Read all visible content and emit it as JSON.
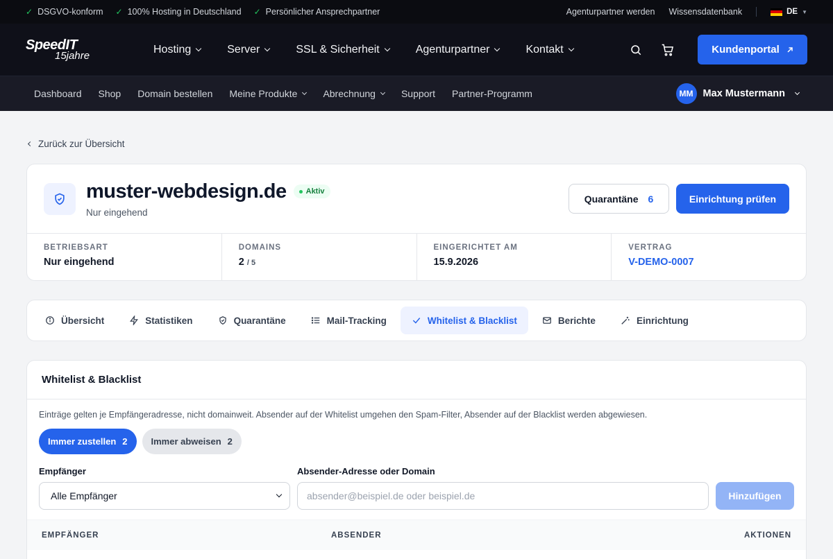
{
  "topbar": {
    "features": [
      "DSGVO-konform",
      "100% Hosting in Deutschland",
      "Persönlicher Ansprechpartner"
    ],
    "links": [
      "Agenturpartner werden",
      "Wissensdatenbank"
    ],
    "language": "DE"
  },
  "mainnav": {
    "logo_line1": "SpeedIT",
    "logo_line2": "15jahre",
    "items": [
      "Hosting",
      "Server",
      "SSL & Sicherheit",
      "Agenturpartner",
      "Kontakt"
    ],
    "portal_label": "Kundenportal"
  },
  "subnav": {
    "items": [
      "Dashboard",
      "Shop",
      "Domain bestellen",
      "Meine Produkte",
      "Abrechnung",
      "Support",
      "Partner-Programm"
    ],
    "user_initials": "MM",
    "user_name": "Max Mustermann"
  },
  "back_label": "Zurück zur Übersicht",
  "domain": {
    "name": "muster-webdesign.de",
    "status": "Aktiv",
    "subtitle": "Nur eingehend",
    "quarantine_label": "Quarantäne",
    "quarantine_count": "6",
    "check_label": "Einrichtung prüfen",
    "stats": [
      {
        "label": "BETRIEBSART",
        "value": "Nur eingehend"
      },
      {
        "label": "DOMAINS",
        "value": "2",
        "suffix": "/ 5"
      },
      {
        "label": "EINGERICHTET AM",
        "value": "15.9.2026"
      },
      {
        "label": "VERTRAG",
        "value": "V-DEMO-0007"
      }
    ]
  },
  "tabs": [
    {
      "label": "Übersicht",
      "icon": "info-icon"
    },
    {
      "label": "Statistiken",
      "icon": "bolt-icon"
    },
    {
      "label": "Quarantäne",
      "icon": "shield-icon"
    },
    {
      "label": "Mail-Tracking",
      "icon": "list-icon"
    },
    {
      "label": "Whitelist & Blacklist",
      "icon": "check-icon",
      "active": true
    },
    {
      "label": "Berichte",
      "icon": "mail-icon"
    },
    {
      "label": "Einrichtung",
      "icon": "wand-icon"
    }
  ],
  "whitelist": {
    "title": "Whitelist & Blacklist",
    "description": "Einträge gelten je Empfängeradresse, nicht domainweit. Absender auf der Whitelist umgehen den Spam-Filter, Absender auf der Blacklist werden abgewiesen.",
    "pills": [
      {
        "label": "Immer zustellen",
        "count": "2"
      },
      {
        "label": "Immer abweisen",
        "count": "2"
      }
    ],
    "recipient_label": "Empfänger",
    "recipient_value": "Alle Empfänger",
    "sender_label": "Absender-Adresse oder Domain",
    "sender_placeholder": "absender@beispiel.de oder beispiel.de",
    "add_label": "Hinzufügen",
    "columns": [
      "EMPFÄNGER",
      "ABSENDER",
      "AKTIONEN"
    ]
  },
  "colors": {
    "accent": "#2563eb",
    "topbar_bg": "#0b0c11",
    "nav_bg": "#0f1019",
    "subnav_bg": "#1a1b26",
    "success": "#22c55e"
  }
}
